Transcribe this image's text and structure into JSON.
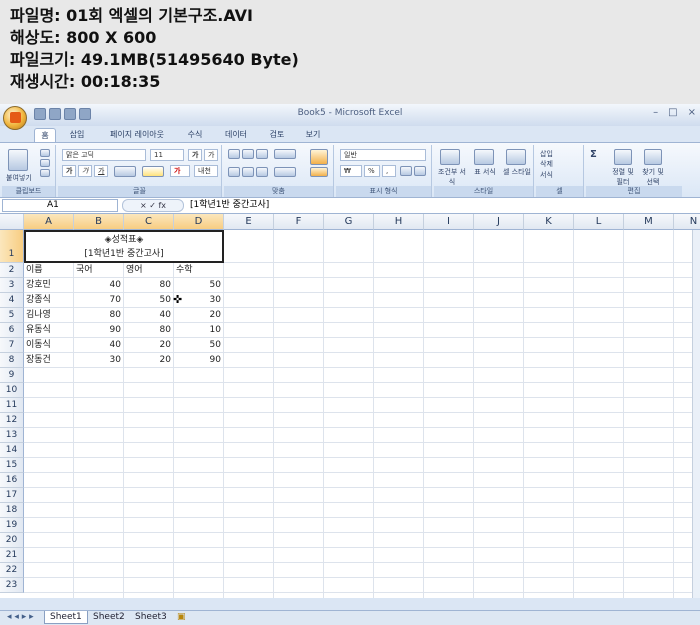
{
  "info": {
    "line1": "파일명: 01회 엑셀의 기본구조.AVI",
    "line2": "해상도: 800 X 600",
    "line3": "파일크기: 49.1MB(51495640 Byte)",
    "line4": "재생시간: 00:18:35"
  },
  "window": {
    "title": "Book5 - Microsoft Excel",
    "min": "–",
    "max": "□",
    "close": "×"
  },
  "tabs": [
    "홈",
    "삽입",
    "페이지 레이아웃",
    "수식",
    "데이터",
    "검토",
    "보기"
  ],
  "ribbon": {
    "clipboard": {
      "label": "클립보드",
      "paste": "붙여넣기"
    },
    "font": {
      "label": "글꼴",
      "name": "맑은 고딕",
      "size": "11",
      "bold": "가",
      "italic": "가",
      "underline": "가",
      "grow": "가",
      "shrink": "가",
      "color": "가",
      "fill": "내천"
    },
    "align": {
      "label": "맞춤"
    },
    "number": {
      "label": "표시 형식",
      "format": "일반",
      "currency": "₩",
      "percent": "%",
      "comma": ","
    },
    "styles": {
      "label": "스타일",
      "cond": "조건부 서식",
      "table": "표 서식",
      "cellstyle": "셀 스타일"
    },
    "cells": {
      "label": "셀",
      "insert": "삽입",
      "delete": "삭제",
      "format": "서식"
    },
    "edit": {
      "label": "편집",
      "sigma": "Σ",
      "sort": "정렬 및 필터",
      "find": "찾기 및 선택"
    }
  },
  "formula": {
    "namebox": "A1",
    "fx": "fx",
    "value": "[1학년1반 중간고사]"
  },
  "columns": [
    "A",
    "B",
    "C",
    "D",
    "E",
    "F",
    "G",
    "H",
    "I",
    "J",
    "K",
    "L",
    "M",
    "N"
  ],
  "rows": [
    "1",
    "2",
    "3",
    "4",
    "5",
    "6",
    "7",
    "8",
    "9",
    "10",
    "11",
    "12",
    "13",
    "14",
    "15",
    "16",
    "17",
    "18",
    "19",
    "20",
    "21",
    "22",
    "23"
  ],
  "sheet": {
    "title1": "◈성적표◈",
    "title2": "[1학년1반 중간고사]",
    "headers": [
      "이름",
      "국어",
      "영어",
      "수학"
    ],
    "data": [
      [
        "강호민",
        "40",
        "80",
        "50"
      ],
      [
        "강종식",
        "70",
        "50",
        "30"
      ],
      [
        "김나영",
        "80",
        "40",
        "20"
      ],
      [
        "유동식",
        "90",
        "80",
        "10"
      ],
      [
        "이동식",
        "40",
        "20",
        "50"
      ],
      [
        "장동건",
        "30",
        "20",
        "90"
      ]
    ]
  },
  "sheettabs": [
    "Sheet1",
    "Sheet2",
    "Sheet3"
  ]
}
